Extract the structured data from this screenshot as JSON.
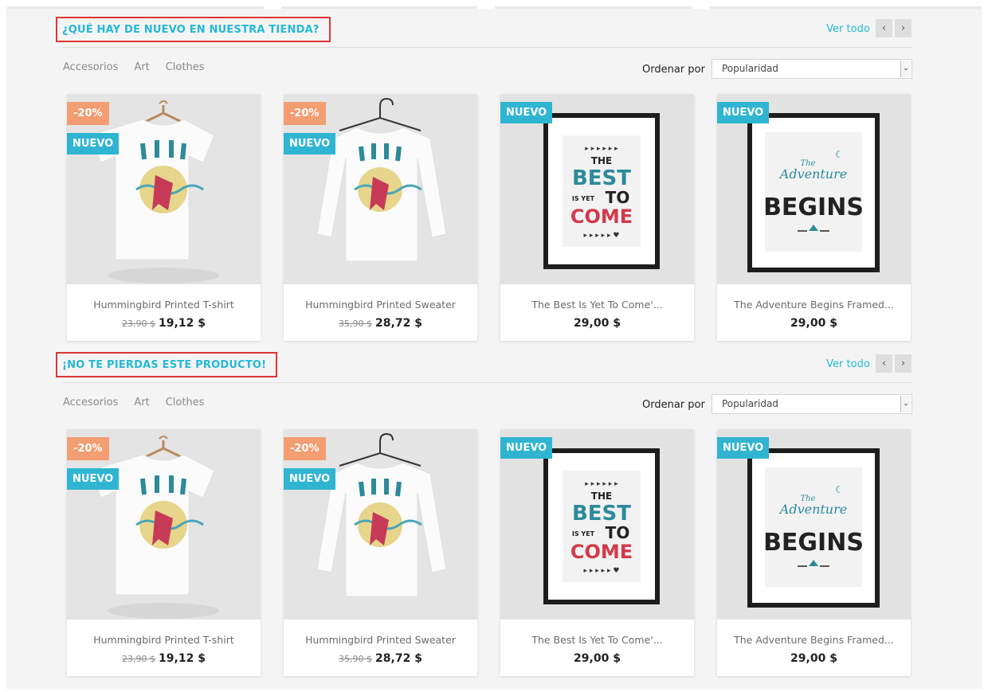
{
  "sections": [
    {
      "title": "¿QUÉ HAY DE NUEVO EN NUESTRA TIENDA?",
      "view_all": "Ver todo",
      "categories": [
        "Accesorios",
        "Art",
        "Clothes"
      ],
      "sort_label": "Ordenar por",
      "sort_value": "Popularidad",
      "products": [
        {
          "name": "Hummingbird Printed T-shirt",
          "old_price": "23,90 $",
          "price": "19,12 $",
          "discount": "-20%",
          "new": "NUEVO",
          "image": "tshirt"
        },
        {
          "name": "Hummingbird Printed Sweater",
          "old_price": "35,90 $",
          "price": "28,72 $",
          "discount": "-20%",
          "new": "NUEVO",
          "image": "sweater"
        },
        {
          "name": "The Best Is Yet To Come'...",
          "old_price": "",
          "price": "29,00 $",
          "discount": "",
          "new": "NUEVO",
          "image": "poster-best"
        },
        {
          "name": "The Adventure Begins Framed...",
          "old_price": "",
          "price": "29,00 $",
          "discount": "",
          "new": "NUEVO",
          "image": "poster-adventure"
        }
      ]
    },
    {
      "title": "¡NO TE PIERDAS ESTE PRODUCTO!",
      "view_all": "Ver todo",
      "categories": [
        "Accesorios",
        "Art",
        "Clothes"
      ],
      "sort_label": "Ordenar por",
      "sort_value": "Popularidad",
      "products": [
        {
          "name": "Hummingbird Printed T-shirt",
          "old_price": "23,90 $",
          "price": "19,12 $",
          "discount": "-20%",
          "new": "NUEVO",
          "image": "tshirt"
        },
        {
          "name": "Hummingbird Printed Sweater",
          "old_price": "35,90 $",
          "price": "28,72 $",
          "discount": "-20%",
          "new": "NUEVO",
          "image": "sweater"
        },
        {
          "name": "The Best Is Yet To Come'...",
          "old_price": "",
          "price": "29,00 $",
          "discount": "",
          "new": "NUEVO",
          "image": "poster-best"
        },
        {
          "name": "The Adventure Begins Framed...",
          "old_price": "",
          "price": "29,00 $",
          "discount": "",
          "new": "NUEVO",
          "image": "poster-adventure"
        }
      ]
    }
  ],
  "poster_text": {
    "best": [
      "THE",
      "BEST",
      "IS YET",
      "TO",
      "COME"
    ],
    "adventure": [
      "The",
      "Adventure",
      "BEGINS"
    ]
  },
  "colors": {
    "accent": "#24b9d7",
    "discount": "#f39d72",
    "new_badge": "#2fb5d2",
    "highlight_box": "#e03434"
  }
}
